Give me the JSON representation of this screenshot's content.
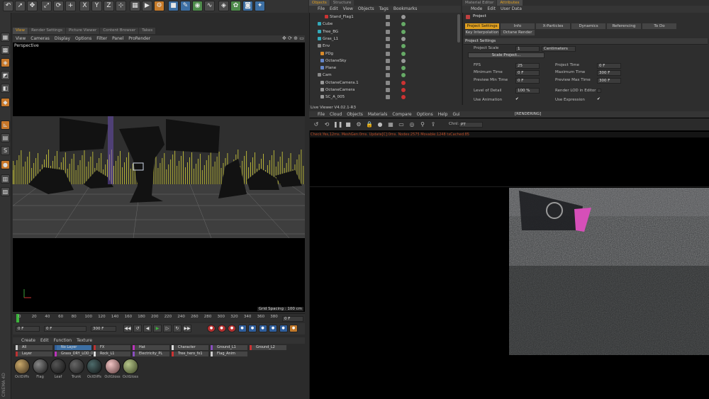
{
  "toolbar": {
    "icons": [
      "undo-icon",
      "pointer-icon",
      "move-icon",
      "scale-icon",
      "rotate-icon",
      "add-icon",
      "axis-x-icon",
      "axis-y-icon",
      "axis-z-icon",
      "coord-icon",
      "render-view-icon",
      "render-icon",
      "render-settings-icon",
      "cube-icon",
      "pen-icon",
      "subdivide-icon",
      "spline-icon",
      "deform-icon",
      "scene-icon",
      "camera-icon",
      "light-icon"
    ],
    "x_label": "X",
    "y_label": "Y",
    "z_label": "Z"
  },
  "viewport": {
    "tabs": [
      "View",
      "Render Settings",
      "Picture Viewer",
      "Content Browser",
      "Takes"
    ],
    "menu": [
      "View",
      "Cameras",
      "Display",
      "Options",
      "Filter",
      "Panel",
      "ProRender"
    ],
    "camera_label": "Perspective",
    "grid_spacing": "Grid Spacing : 100 cm"
  },
  "timeline": {
    "ticks": [
      "0",
      "20",
      "40",
      "60",
      "80",
      "100",
      "120",
      "140",
      "160",
      "180",
      "200",
      "220",
      "240",
      "260",
      "280",
      "300",
      "320",
      "340",
      "360",
      "380"
    ],
    "end_frame": "0 F",
    "current": "0 F",
    "min": "0 F",
    "range_end": "300 F",
    "max": "300 F"
  },
  "material_manager": {
    "menu": [
      "Create",
      "Edit",
      "Function",
      "Texture"
    ],
    "layers_row1": [
      "All",
      "No Layer",
      "FX",
      "Hat",
      "Character",
      "Ground_L1",
      "Ground_L2"
    ],
    "layers_row2": [
      "Layer",
      "Grass_DRY_LOD_01",
      "Rock_L1",
      "Electricity_PL",
      "Tree_hero_fx1",
      "Flag_Anim"
    ],
    "materials": [
      "OctDiffs",
      "Flag",
      "Leaf",
      "Trunk",
      "OctDiffs",
      "OctGloss",
      "OctGloss"
    ],
    "side_label": "CINEMA 4D"
  },
  "objects_panel": {
    "tabs": [
      "Objects",
      "Structure"
    ],
    "menu": [
      "File",
      "Edit",
      "View",
      "Objects",
      "Tags",
      "Bookmarks"
    ],
    "items": [
      "Stand_Flag1",
      "Cube",
      "Tree_BG",
      "Gras_L1",
      "Env",
      "PDg",
      "OctaneSky",
      "Plane",
      "Cam",
      "OctaneCamera.1",
      "OctaneCamera",
      "SC_A_005"
    ]
  },
  "attributes_panel": {
    "tabs": [
      "Material Editor",
      "Attributes"
    ],
    "menu": [
      "Mode",
      "Edit",
      "User Data"
    ],
    "title": "Project",
    "tab_row1": [
      "Project Settings",
      "Info",
      "X-Particles",
      "Dynamics",
      "Referencing",
      "To Do"
    ],
    "tab_row2": [
      "Key Interpolation",
      "Octane Render"
    ],
    "section": "Project Settings",
    "project_scale_label": "Project Scale",
    "project_scale_value": "1",
    "project_scale_unit": "Centimeters",
    "scale_button": "Scale Project...",
    "fps_label": "FPS",
    "fps": "25",
    "project_time_label": "Project Time",
    "project_time": "0 F",
    "min_time_label": "Minimum Time",
    "min_time": "0 F",
    "max_time_label": "Maximum Time",
    "max_time": "300 F",
    "prev_min_label": "Preview Min Time",
    "prev_min": "0 F",
    "prev_max_label": "Preview Max Time",
    "prev_max": "300 F",
    "lod_label": "Level of Detail",
    "lod": "100 %",
    "render_lod_label": "Render LOD in Editor",
    "use_anim_label": "Use Animation",
    "use_expr_label": "Use Expression",
    "check": "✔"
  },
  "live_viewer": {
    "title": "Live Viewer V4.02.1-R3",
    "menu": [
      "File",
      "Cloud",
      "Objects",
      "Materials",
      "Compare",
      "Options",
      "Help",
      "Gui"
    ],
    "status": "[RENDERING]",
    "channel_label": "Chnl:",
    "channel_value": "PT",
    "info": "Check:Yes,12ms. MeshGen:0ms. Update[C]:0ms. Nodes:2575 Movable:1248 txCached:85"
  },
  "colors": {
    "accent_orange": "#e0a020",
    "selection": "#4a6f9c",
    "bg": "#2b2b2b"
  }
}
